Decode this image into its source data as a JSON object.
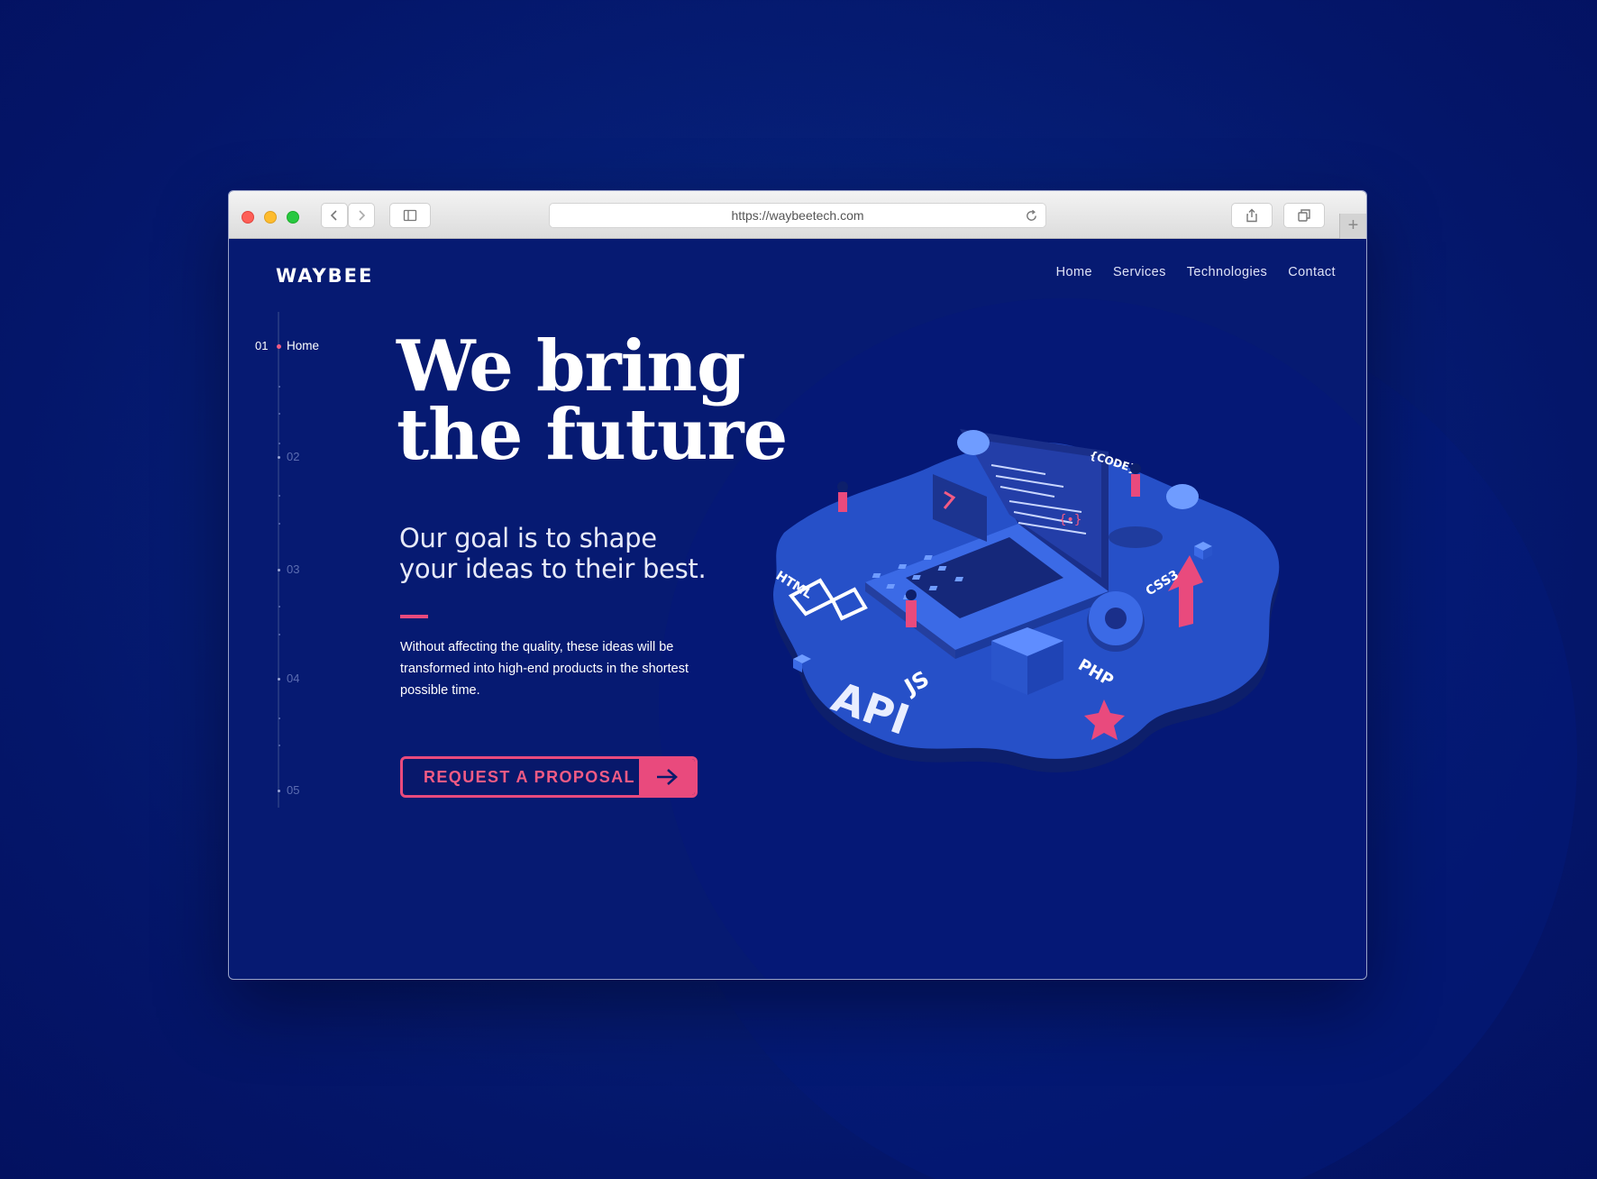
{
  "browser": {
    "url": "https://waybeetech.com",
    "new_tab_label": "+"
  },
  "header": {
    "logo": "WAYBEE",
    "nav": [
      {
        "label": "Home"
      },
      {
        "label": "Services"
      },
      {
        "label": "Technologies"
      },
      {
        "label": "Contact"
      }
    ]
  },
  "sidebar": {
    "steps": [
      {
        "num": "01",
        "label": "Home",
        "active": true
      },
      {
        "num": "02"
      },
      {
        "num": "03"
      },
      {
        "num": "04"
      },
      {
        "num": "05"
      }
    ]
  },
  "hero": {
    "headline_line1": "We bring",
    "headline_line2": "the future",
    "tagline_line1": "Our goal is to shape",
    "tagline_line2": "your ideas to their best.",
    "body": "Without affecting the quality, these ideas will be transformed into high-end products in the shortest possible time.",
    "cta_label": "REQUEST A PROPOSAL"
  },
  "illustration": {
    "labels": [
      "HTML",
      "{CODE}",
      "CSS3",
      "API",
      "JS",
      "PHP"
    ]
  },
  "colors": {
    "accent": "#e94a7d",
    "background": "#061a72",
    "illustration_blue": "#2f5bd8"
  }
}
